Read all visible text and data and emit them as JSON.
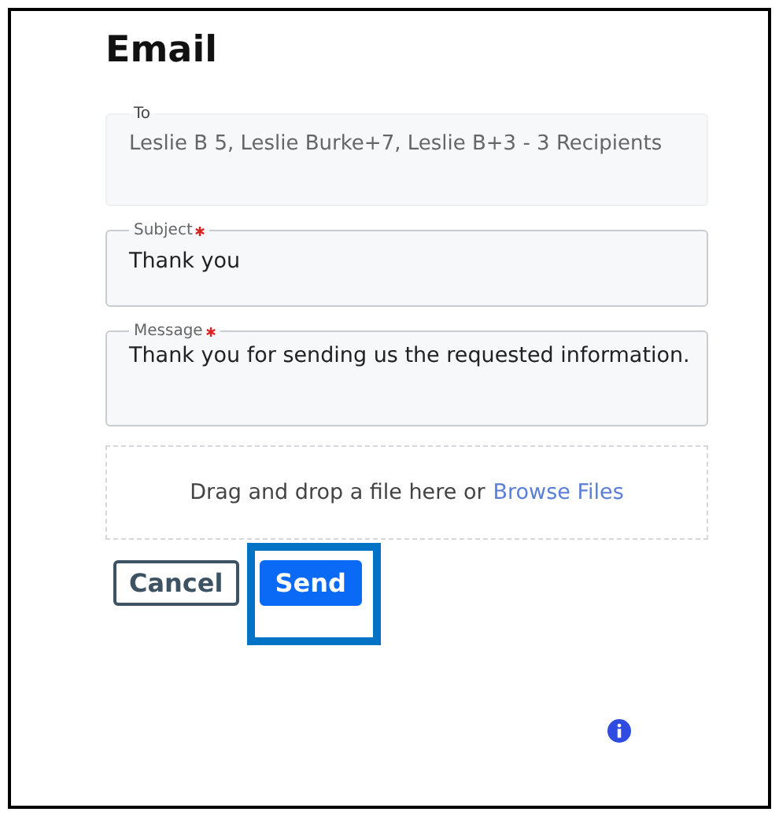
{
  "title": "Email",
  "fields": [
    {
      "kind": "line",
      "label": "To",
      "value": "Leslie B 5, Leslie Burke+7, Leslie B+3 - 3 Recipients",
      "required": false,
      "disabled": true
    },
    {
      "kind": "line",
      "label": "Subject",
      "value": "Thank you",
      "required": true,
      "disabled": false
    },
    {
      "kind": "area",
      "label": "Message",
      "value": "Thank you for sending us the requested information.",
      "required": true,
      "disabled": false
    }
  ],
  "dropzone": {
    "text": "Drag and drop a file here or",
    "link": "Browse Files"
  },
  "buttons": [
    {
      "label": "Cancel",
      "kind": "secondary",
      "highlighted": false
    },
    {
      "label": "Send",
      "kind": "primary",
      "highlighted": true
    }
  ]
}
